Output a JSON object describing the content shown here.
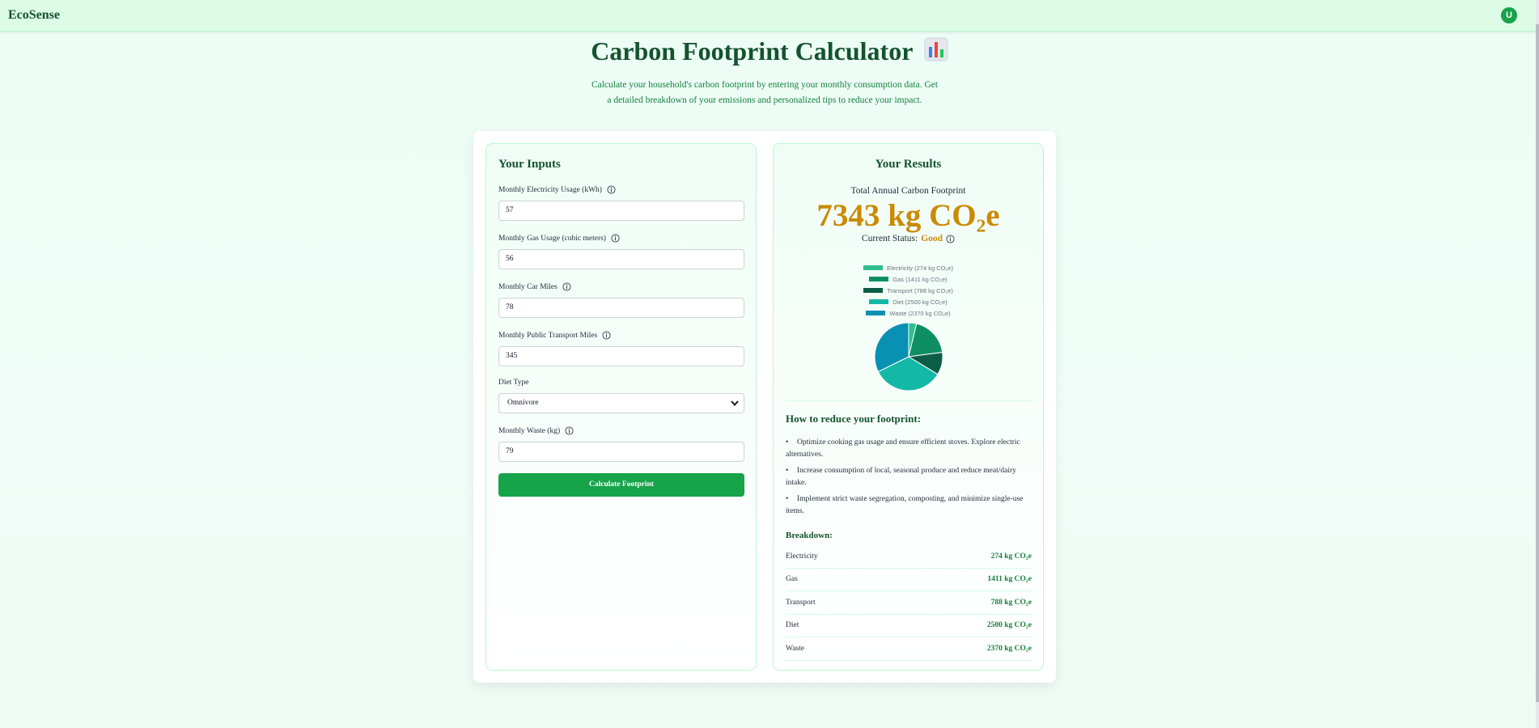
{
  "app": {
    "brand": "EcoSense",
    "avatar_initial": "U"
  },
  "header": {
    "title": "Carbon Footprint Calculator",
    "title_icon": "bar-chart-emoji-icon",
    "subtitle": "Calculate your household's carbon footprint by entering your monthly consumption data. Get a detailed breakdown of your emissions and personalized tips to reduce your impact."
  },
  "inputs": {
    "title": "Your Inputs",
    "fields": [
      {
        "label": "Monthly Electricity Usage (kWh)",
        "value": "57",
        "has_info": true
      },
      {
        "label": "Monthly Gas Usage (cubic meters)",
        "value": "56",
        "has_info": true
      },
      {
        "label": "Monthly Car Miles",
        "value": "78",
        "has_info": true
      },
      {
        "label": "Monthly Public Transport Miles",
        "value": "345",
        "has_info": true
      }
    ],
    "diet": {
      "label": "Diet Type",
      "value": "Omnivore"
    },
    "waste": {
      "label": "Monthly Waste (kg)",
      "value": "79"
    },
    "button_label": "Calculate Footprint"
  },
  "results": {
    "title": "Your Results",
    "total_label": "Total Annual Carbon Footprint",
    "total_value": "7343 kg CO₂e",
    "status_label": "Current Status:",
    "status_value": "Good",
    "tips_title": "How to reduce your footprint:",
    "tips": [
      "Optimize cooking gas usage and ensure efficient stoves. Explore electric alternatives.",
      "Increase consumption of local, seasonal produce and reduce meat/dairy intake.",
      "Implement strict waste segregation, composting, and minimize single-use items."
    ],
    "breakdown_title": "Breakdown:",
    "breakdown": [
      {
        "label": "Electricity",
        "value": "274 kg CO₂e"
      },
      {
        "label": "Gas",
        "value": "1411 kg CO₂e"
      },
      {
        "label": "Transport",
        "value": "788 kg CO₂e"
      },
      {
        "label": "Diet",
        "value": "2500 kg CO₂e"
      },
      {
        "label": "Waste",
        "value": "2370 kg CO₂e"
      }
    ]
  },
  "colors": {
    "primary": "#16a34a",
    "accent_amber": "#ca8a04",
    "dark_green": "#14532d"
  },
  "chart_data": {
    "type": "pie",
    "labels": [
      "Electricity",
      "Gas",
      "Transport",
      "Diet",
      "Waste"
    ],
    "values": [
      274,
      1411,
      788,
      2500,
      2370
    ],
    "legend": [
      "Electricity (274 kg CO₂e)",
      "Gas (1411 kg CO₂e)",
      "Transport (788 kg CO₂e)",
      "Diet (2500 kg CO₂e)",
      "Waste (2370 kg CO₂e)"
    ],
    "colors": [
      "#2fbf8c",
      "#0e8f63",
      "#0b5e45",
      "#14b8a6",
      "#0891b2"
    ],
    "legend_position": "top"
  }
}
